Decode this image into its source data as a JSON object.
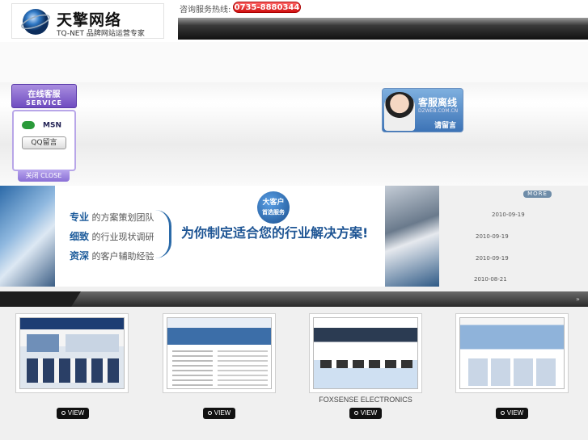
{
  "header": {
    "logo_cn": "天擎网络",
    "logo_en": "TQ-NET 品牌网站运营专家",
    "hotline_label": "咨询服务热线:",
    "hotline_number": "0735-8880344"
  },
  "service": {
    "title": "在线客服",
    "subtitle": "SERVICE",
    "msn": "MSN",
    "qq": "QQ留言",
    "close": "关闭 CLOSE"
  },
  "offline": {
    "title": "客服离线",
    "url": "DZWEB.COM.CN",
    "message": "请留言"
  },
  "banner": {
    "line1_key": "专业",
    "line1_rest": "的方案策划团队",
    "line2_key": "细致",
    "line2_rest": "的行业现状调研",
    "line3_key": "资深",
    "line3_rest": "的客户辅助经验",
    "badge_line1": "大客户",
    "badge_line2": "首选服务",
    "slogan": "为你制定适合您的行业解决方案!"
  },
  "news": {
    "more": "MORE",
    "dates": [
      "2010-09-19",
      "2010-09-19",
      "2010-09-19",
      "2010-08-21"
    ]
  },
  "divider_mark": "»",
  "portfolio": [
    {
      "caption": "",
      "view": "VIEW"
    },
    {
      "caption": "",
      "view": "VIEW"
    },
    {
      "caption": "FOXSENSE ELECTRONICS",
      "view": "VIEW"
    },
    {
      "caption": "",
      "view": "VIEW"
    }
  ],
  "colors": {
    "accent_red": "#d01010",
    "service_purple": "#6f4cc0",
    "brand_blue": "#1e5594"
  }
}
